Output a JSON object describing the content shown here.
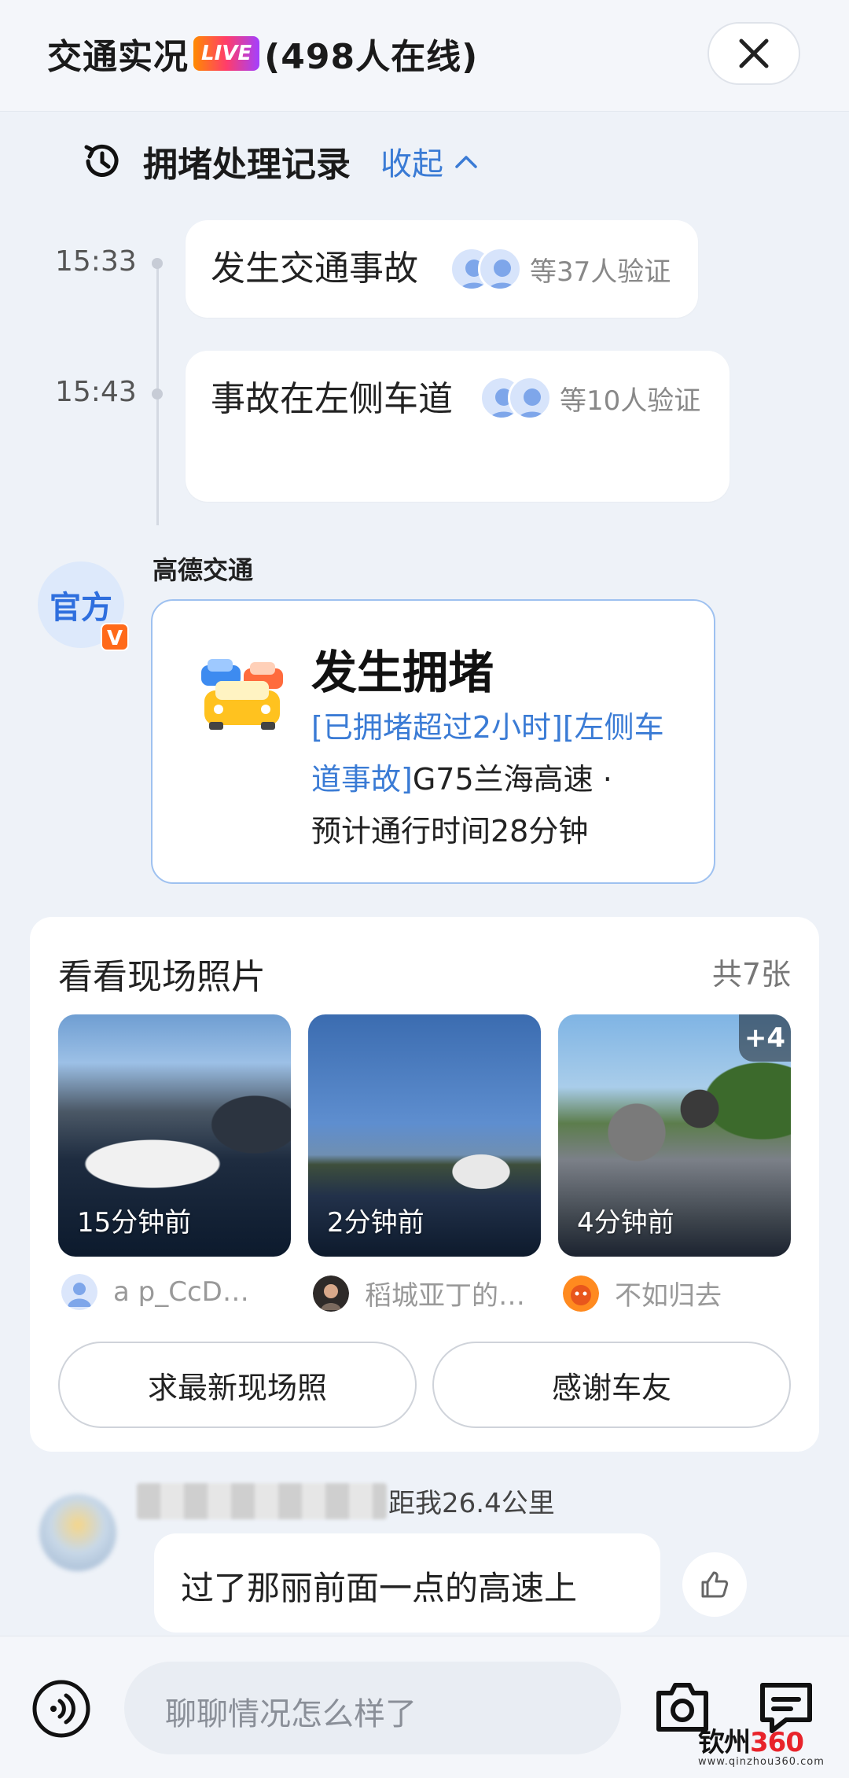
{
  "header": {
    "title": "交通实况",
    "live_badge": "LIVE",
    "online": "(498人在线)"
  },
  "record": {
    "title": "拥堵处理记录",
    "collapse_label": "收起",
    "events": [
      {
        "time": "15:33",
        "text": "发生交通事故",
        "verify": "等37人验证"
      },
      {
        "time": "15:43",
        "text": "事故在左侧车道",
        "verify": "等10人验证"
      }
    ]
  },
  "official": {
    "avatar_label": "官方",
    "verified_badge": "V",
    "name": "高德交通",
    "card_title": "发生拥堵",
    "tag_line": "[已拥堵超过2小时][左侧车道事故]",
    "road": "G75兰海高速 ·",
    "eta": "预计通行时间28分钟"
  },
  "photos": {
    "title": "看看现场照片",
    "count": "共7张",
    "items": [
      {
        "caption": "15分钟前",
        "uploader": "a p_CcD…"
      },
      {
        "caption": "2分钟前",
        "uploader": "稻城亚丁的…"
      },
      {
        "caption": "4分钟前",
        "uploader": "不如归去",
        "more": "+4"
      }
    ],
    "request_button": "求最新现场照",
    "thanks_button": "感谢车友"
  },
  "comment": {
    "distance": "距我26.4公里",
    "text": "过了那丽前面一点的高速上"
  },
  "bottom": {
    "input_placeholder": "聊聊情况怎么样了"
  },
  "watermark": {
    "main_prefix": "钦州",
    "main_num": "360",
    "url": "www.qinzhou360.com"
  },
  "colors": {
    "accent_blue": "#3a7bd5",
    "official_badge": "#ff6a1a",
    "card_border": "#9ec1f0"
  }
}
